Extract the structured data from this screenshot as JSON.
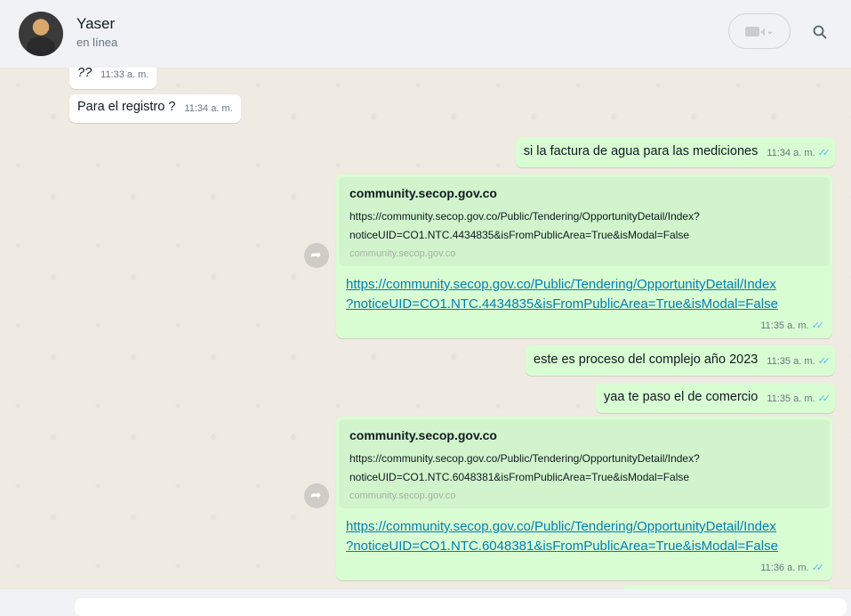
{
  "header": {
    "contact_name": "Yaser",
    "status": "en línea",
    "icons": [
      "video-call-icon",
      "chevron-down-icon",
      "search-icon"
    ]
  },
  "messages": [
    {
      "dir": "in",
      "text": "??",
      "time": "11:33 a. m."
    },
    {
      "dir": "in",
      "text": "Para el registro ?",
      "time": "11:34 a. m."
    },
    {
      "dir": "out",
      "text": "si la factura de agua para las mediciones",
      "time": "11:34 a. m."
    },
    {
      "dir": "out",
      "type": "link",
      "preview_title": "community.secop.gov.co",
      "preview_desc_1": "https://community.secop.gov.co/Public/Tendering/OpportunityDetail/Index?",
      "preview_desc_2": "noticeUID=CO1.NTC.4434835&isFromPublicArea=True&isModal=False",
      "preview_domain": "community.secop.gov.co",
      "url_line_1": "https://community.secop.gov.co/Public/Tendering/OpportunityDetail/Index",
      "url_line_2": "?noticeUID=CO1.NTC.4434835&isFromPublicArea=True&isModal=False",
      "time": "11:35 a. m."
    },
    {
      "dir": "out",
      "text": "este es proceso del complejo año 2023",
      "time": "11:35 a. m."
    },
    {
      "dir": "out",
      "text": "yaa te paso el de comercio",
      "time": "11:35 a. m."
    },
    {
      "dir": "out",
      "type": "link",
      "preview_title": "community.secop.gov.co",
      "preview_desc_1": "https://community.secop.gov.co/Public/Tendering/OpportunityDetail/Index?",
      "preview_desc_2": "noticeUID=CO1.NTC.6048381&isFromPublicArea=True&isModal=False",
      "preview_domain": "community.secop.gov.co",
      "url_line_1": "https://community.secop.gov.co/Public/Tendering/OpportunityDetail/Index",
      "url_line_2": "?noticeUID=CO1.NTC.6048381&isFromPublicArea=True&isModal=False",
      "time": "11:36 a. m."
    }
  ],
  "colors": {
    "incoming": "#ffffff",
    "outgoing": "#d9fdd3",
    "link": "#027eb5",
    "ticks": "#53bdeb"
  }
}
